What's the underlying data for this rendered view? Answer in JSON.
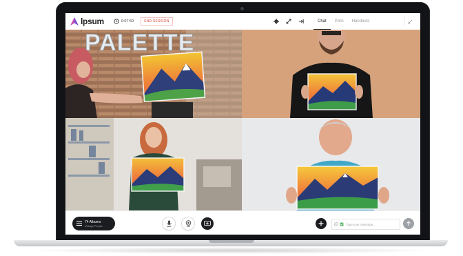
{
  "app": {
    "brand": "lpsum",
    "timer": "0:07:59",
    "end_session_label": "END SESSION"
  },
  "colors": {
    "accent": "#7b4dd8",
    "end_session": "#e0463d",
    "dark_control": "#1e1f22"
  },
  "toolbar": {
    "icons": [
      "gear-icon",
      "expand-icon",
      "exit-icon"
    ]
  },
  "tabs": [
    {
      "label": "Chat",
      "active": true
    },
    {
      "label": "Polls",
      "active": false
    },
    {
      "label": "Handouts",
      "active": false
    }
  ],
  "album": {
    "title": "74 Albums",
    "subtitle": "Vintage People"
  },
  "chat": {
    "placeholder": "Type your message..."
  },
  "wall_text": "PALETTE"
}
